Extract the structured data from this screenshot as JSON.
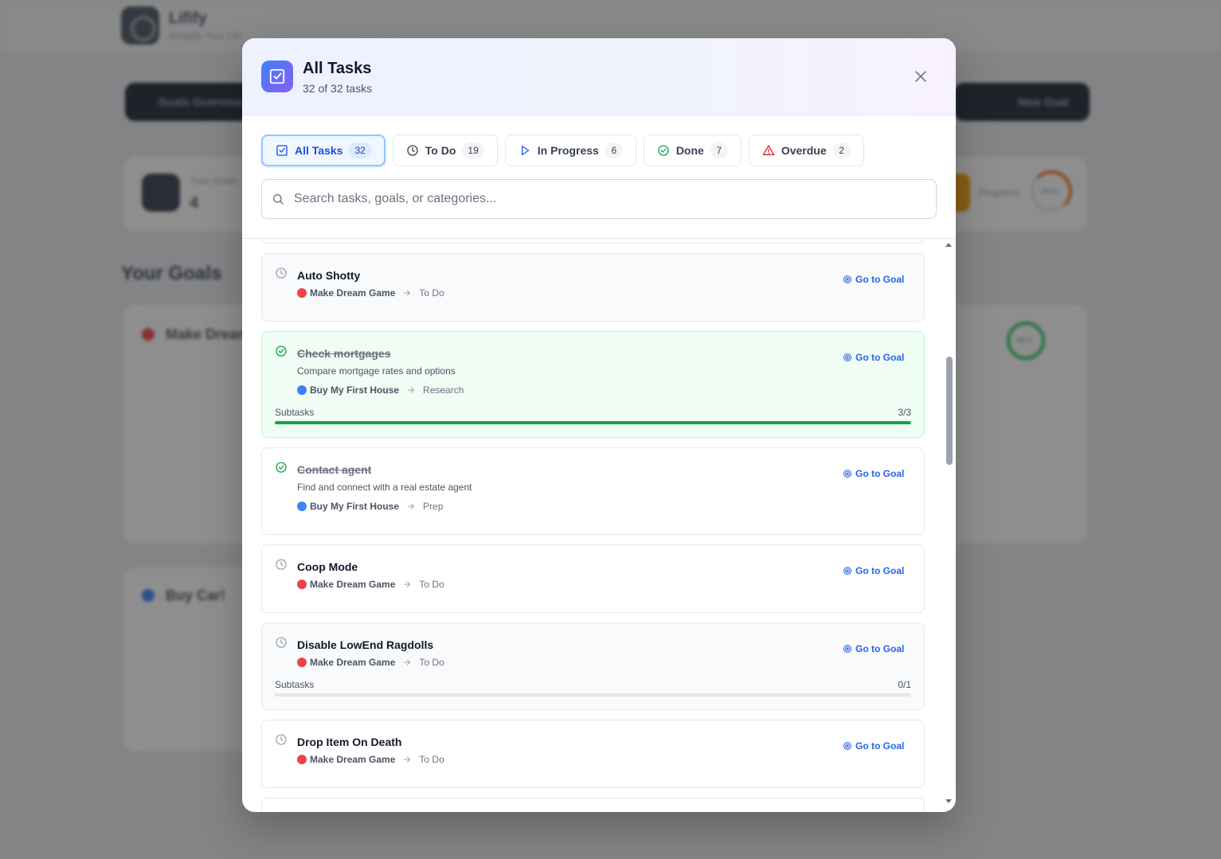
{
  "background": {
    "brand": "Lifify",
    "tagline": "Simplify Your Life",
    "goals_overview_button": "Goals Overview",
    "new_goal_button": "New Goal",
    "total_goals_label": "Total Goals",
    "total_goals_value": "4",
    "progress_label": "Progress",
    "progress_value": "35%",
    "your_goals_title": "Your Goals",
    "goal_1_name": "Make Dream Game",
    "goal_2_name": "Buy Car!",
    "ring_value": "46%"
  },
  "modal": {
    "title": "All Tasks",
    "subtitle": "32 of 32 tasks",
    "tabs": [
      {
        "label": "All Tasks",
        "count": "32"
      },
      {
        "label": "To Do",
        "count": "19"
      },
      {
        "label": "In Progress",
        "count": "6"
      },
      {
        "label": "Done",
        "count": "7"
      },
      {
        "label": "Overdue",
        "count": "2"
      }
    ],
    "search_placeholder": "Search tasks, goals, or categories...",
    "goto_label": "Go to Goal",
    "subtasks_label": "Subtasks",
    "tasks": [
      {
        "title": "Auto Shotty",
        "goal": "Make Dream Game",
        "category": "To Do"
      },
      {
        "title": "Check mortgages",
        "description": "Compare mortgage rates and options",
        "goal": "Buy My First House",
        "category": "Research",
        "subtasks": "3/3"
      },
      {
        "title": "Contact agent",
        "description": "Find and connect with a real estate agent",
        "goal": "Buy My First House",
        "category": "Prep"
      },
      {
        "title": "Coop Mode",
        "goal": "Make Dream Game",
        "category": "To Do"
      },
      {
        "title": "Disable LowEnd Ragdolls",
        "goal": "Make Dream Game",
        "category": "To Do",
        "subtasks": "0/1"
      },
      {
        "title": "Drop Item On Death",
        "goal": "Make Dream Game",
        "category": "To Do"
      }
    ]
  },
  "colors": {
    "goal_red": "#ef4444",
    "goal_blue": "#3b82f6",
    "accent": "#2563eb",
    "done_green": "#16a34a"
  }
}
